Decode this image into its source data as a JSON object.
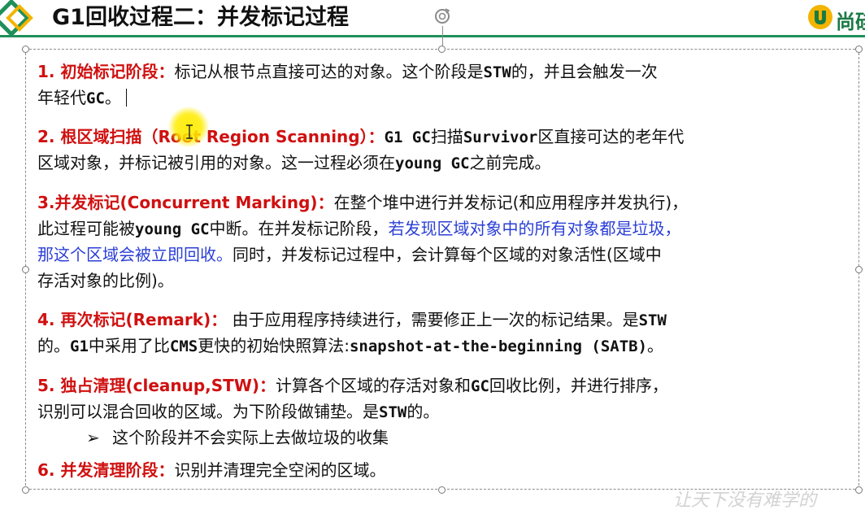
{
  "header": {
    "title": "G1回收过程二：并发标记过程",
    "logo_text": "尚硅",
    "colors": {
      "accent": "#1f8f5a",
      "logo": "#1a7a44",
      "warning": "#f2b400"
    }
  },
  "steps": [
    {
      "heading": "1. 初始标记阶段：",
      "lines": [
        [
          "标记从根节点直接可达的对象。这个阶段是",
          "STW",
          "的，并且会触发一次"
        ],
        [
          "年轻代",
          "GC",
          "。"
        ]
      ]
    },
    {
      "heading": "2. 根区域扫描（Root Region Scanning）：",
      "lines": [
        [
          "G1 GC",
          "扫描",
          "Survivor",
          "区直接可达的老年代"
        ],
        [
          "区域对象，并标记被引用的对象。这一过程必须在",
          "young GC",
          "之前完成。"
        ]
      ]
    },
    {
      "heading": "3.并发标记(Concurrent Marking)：",
      "lines": [
        [
          "在整个堆中进行并发标记(和应用程序并发执行)，"
        ],
        [
          "此过程可能被",
          "young GC",
          "中断。在并发标记阶段，",
          "若发现区域对象中的所有对象都是垃圾，"
        ],
        [
          "那这个区域会被立即回收。",
          "同时，并发标记过程中，会计算每个区域的对象活性(区域中"
        ],
        [
          "存活对象的比例)。"
        ]
      ]
    },
    {
      "heading": "4. 再次标记(Remark)：",
      "lines": [
        [
          "由于应用程序持续进行，需要修正上一次的标记结果。是",
          "STW"
        ],
        [
          "的。",
          "G1",
          "中采用了比",
          "CMS",
          "更快的初始快照算法:",
          "snapshot-at-the-beginning (SATB)",
          "。"
        ]
      ]
    },
    {
      "heading": "5. 独占清理(cleanup,STW)：",
      "lines": [
        [
          "计算各个区域的存活对象和",
          "GC",
          "回收比例，并进行排序，"
        ],
        [
          "识别可以混合回收的区域。为下阶段做铺垫。是",
          "STW",
          "的。"
        ]
      ],
      "sub_bullet": "这个阶段并不会实际上去做垃圾的收集"
    },
    {
      "heading": "6. 并发清理阶段：",
      "lines": [
        [
          "识别并清理完全空闲的区域。"
        ]
      ]
    }
  ],
  "watermark": "让天下没有难学的"
}
